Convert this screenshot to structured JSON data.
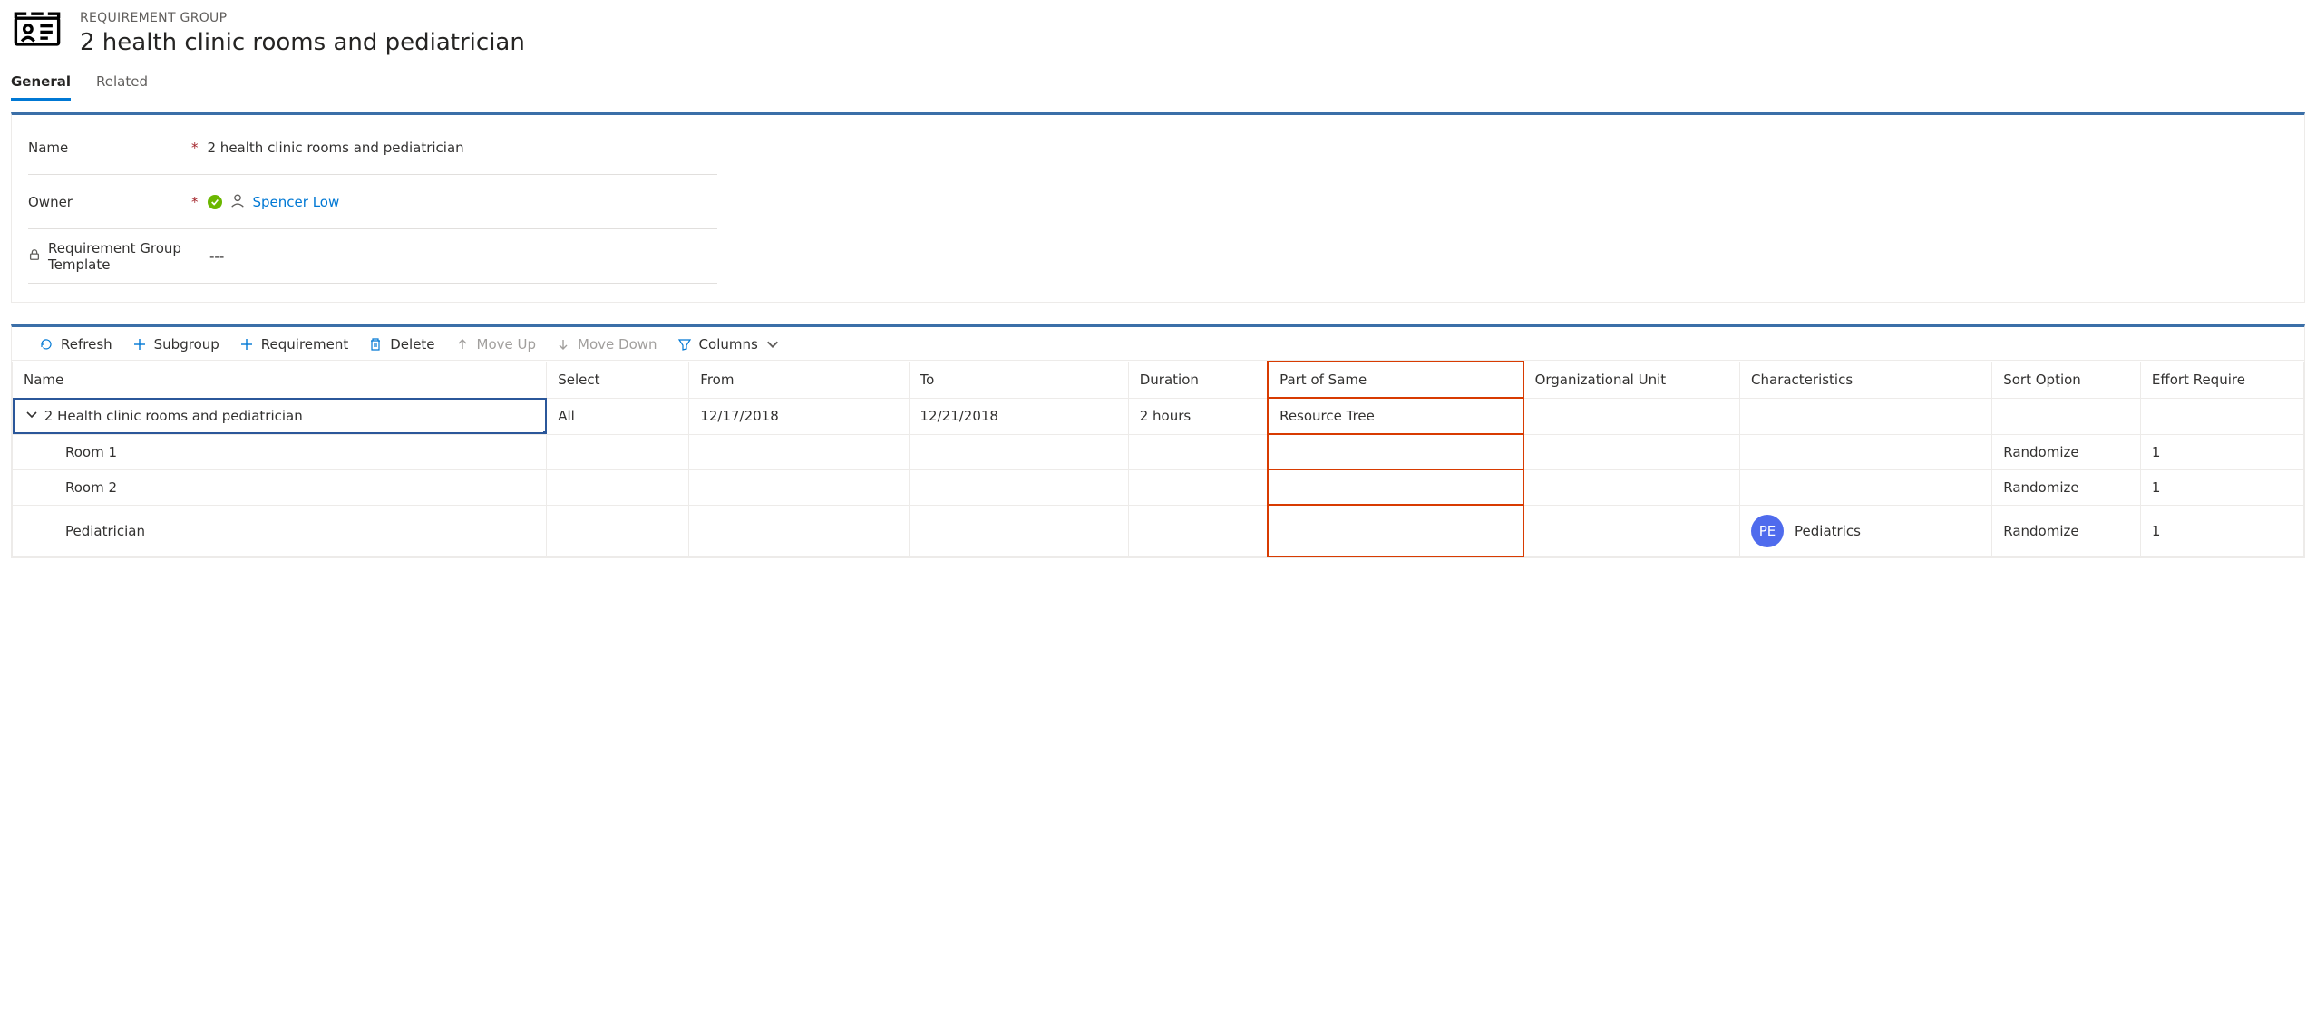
{
  "header": {
    "entity_type": "REQUIREMENT GROUP",
    "entity_title": "2 health clinic rooms and pediatrician"
  },
  "tabs": [
    {
      "label": "General",
      "active": true
    },
    {
      "label": "Related",
      "active": false
    }
  ],
  "form": {
    "name_label": "Name",
    "name_value": "2 health clinic rooms and pediatrician",
    "owner_label": "Owner",
    "owner_value": "Spencer Low",
    "template_label": "Requirement Group Template",
    "template_value": "---"
  },
  "toolbar": {
    "refresh": "Refresh",
    "subgroup": "Subgroup",
    "requirement": "Requirement",
    "delete": "Delete",
    "move_up": "Move Up",
    "move_down": "Move Down",
    "columns": "Columns"
  },
  "grid": {
    "columns": {
      "name": "Name",
      "select": "Select",
      "from": "From",
      "to": "To",
      "duration": "Duration",
      "part_of_same": "Part of Same",
      "org_unit": "Organizational Unit",
      "characteristics": "Characteristics",
      "sort_option": "Sort Option",
      "effort_required": "Effort Require"
    },
    "rows": [
      {
        "name": "2 Health clinic rooms and pediatrician",
        "select": "All",
        "from": "12/17/2018",
        "to": "12/21/2018",
        "duration": "2 hours",
        "part_of_same": "Resource Tree",
        "org_unit": "",
        "characteristics": "",
        "sort_option": "",
        "effort_required": "",
        "expandable": true,
        "selected": true,
        "level": 0
      },
      {
        "name": "Room 1",
        "select": "",
        "from": "",
        "to": "",
        "duration": "",
        "part_of_same": "",
        "org_unit": "",
        "characteristics": "",
        "sort_option": "Randomize",
        "effort_required": "1",
        "level": 1
      },
      {
        "name": "Room 2",
        "select": "",
        "from": "",
        "to": "",
        "duration": "",
        "part_of_same": "",
        "org_unit": "",
        "characteristics": "",
        "sort_option": "Randomize",
        "effort_required": "1",
        "level": 1
      },
      {
        "name": "Pediatrician",
        "select": "",
        "from": "",
        "to": "",
        "duration": "",
        "part_of_same": "",
        "org_unit": "",
        "characteristics": "Pediatrics",
        "characteristics_initials": "PE",
        "sort_option": "Randomize",
        "effort_required": "1",
        "level": 1
      }
    ]
  }
}
